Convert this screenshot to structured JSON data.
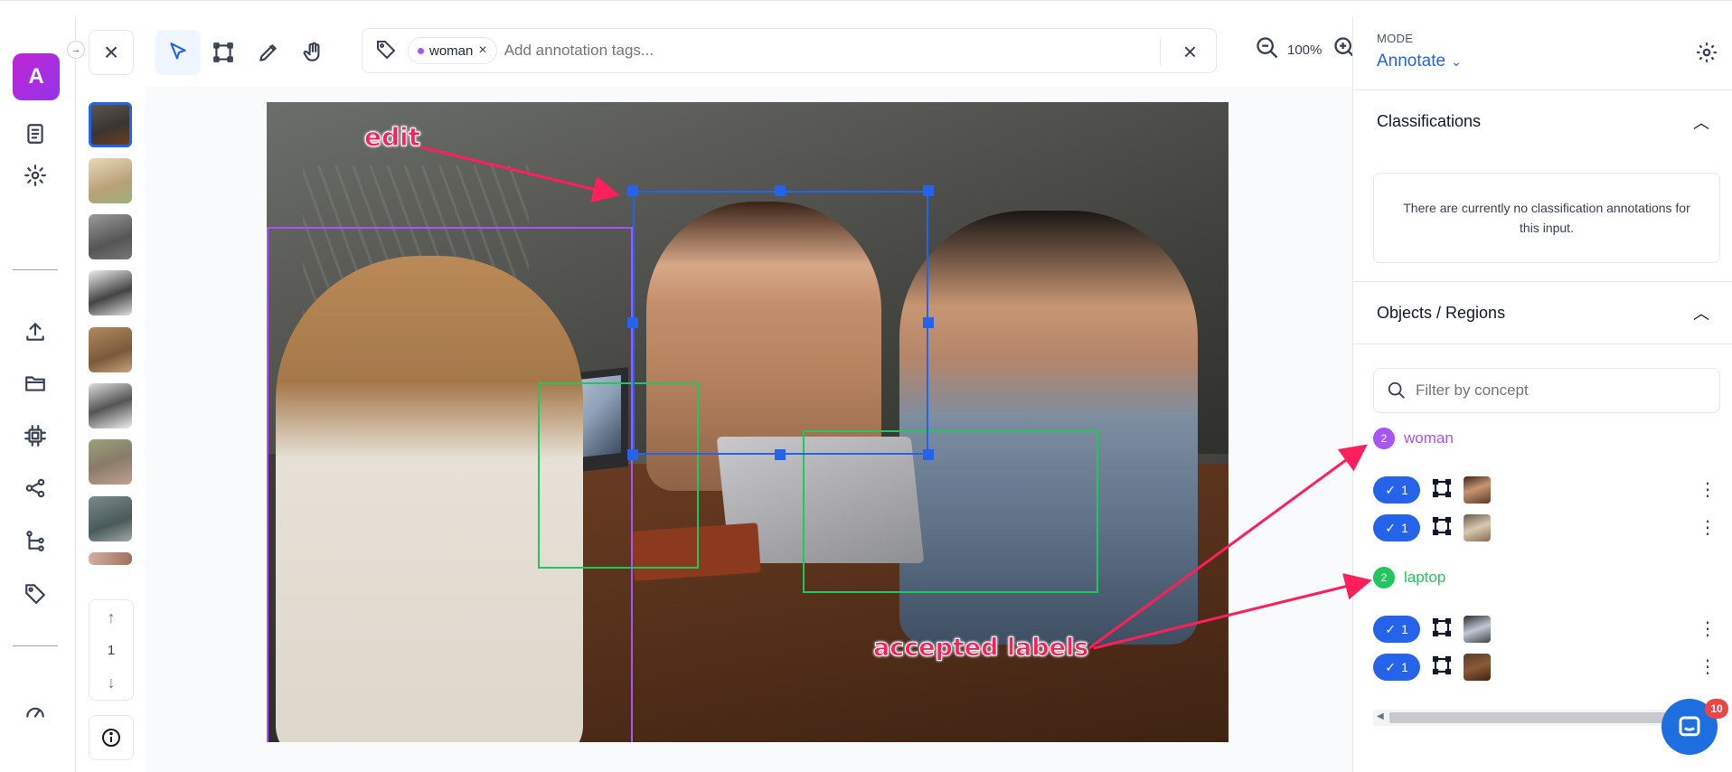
{
  "app": {
    "logo_letter": "A"
  },
  "nav": {
    "items": [
      "document-icon",
      "gear-icon",
      "upload-icon",
      "folder-icon",
      "cpu-icon",
      "share-icon",
      "workflow-icon",
      "tag-icon",
      "gauge-icon"
    ]
  },
  "thumbs": {
    "items": [
      "meeting photo",
      "cat photo",
      "cat photo",
      "cat photo",
      "cat photo",
      "cat photo",
      "cat photo",
      "street photo",
      "photo"
    ]
  },
  "pager": {
    "page": "1"
  },
  "toolbar": {
    "tools": [
      "select-tool",
      "bbox-tool",
      "polygon-tool",
      "pan-tool"
    ],
    "tag_chip": "woman",
    "tag_placeholder": "Add annotation tags...",
    "zoom": "100%"
  },
  "overlay": {
    "edit_label": "edit",
    "accepted_label": "accepted labels"
  },
  "panel": {
    "mode_label": "MODE",
    "mode_value": "Annotate",
    "classifications_title": "Classifications",
    "classifications_empty": "There are currently no classification annotations for this input.",
    "objects_title": "Objects / Regions",
    "filter_placeholder": "Filter by concept",
    "concepts": [
      {
        "name": "woman",
        "count": "2",
        "color": "#a855f7",
        "rows": [
          {
            "accepted": "1"
          },
          {
            "accepted": "1"
          }
        ]
      },
      {
        "name": "laptop",
        "count": "2",
        "color": "#22c55e",
        "rows": [
          {
            "accepted": "1"
          },
          {
            "accepted": "1"
          }
        ]
      }
    ]
  },
  "chat": {
    "badge": "10"
  },
  "colors": {
    "accent": "#2563eb",
    "annotation_pink": "#ff1f5a",
    "woman": "#a855f7",
    "laptop": "#22c55e"
  }
}
